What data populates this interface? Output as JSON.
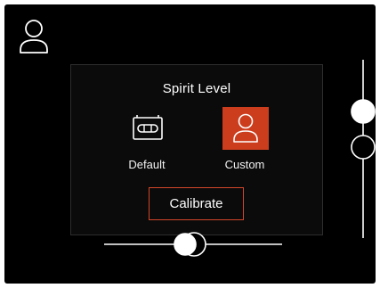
{
  "panel": {
    "title": "Spirit Level",
    "options": [
      {
        "label": "Default",
        "icon": "spirit-level-icon",
        "selected": false
      },
      {
        "label": "Custom",
        "icon": "user-icon",
        "selected": true
      }
    ],
    "calibrate_label": "Calibrate"
  },
  "top_left_icon": "user-icon",
  "colors": {
    "background": "#000000",
    "accent": "#cc3d1e",
    "button_border": "#d2452a",
    "foreground": "#ffffff"
  }
}
